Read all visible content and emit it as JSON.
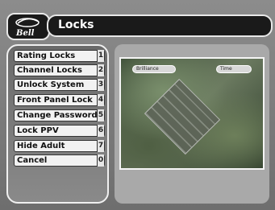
{
  "header": {
    "brand": "Bell",
    "title": "Locks"
  },
  "menu": {
    "items": [
      {
        "label": "Rating Locks",
        "key": "1"
      },
      {
        "label": "Channel Locks",
        "key": "2"
      },
      {
        "label": "Unlock System",
        "key": "3"
      },
      {
        "label": "Front Panel Lock",
        "key": "4"
      },
      {
        "label": "Change Password",
        "key": "5"
      },
      {
        "label": "Lock PPV",
        "key": "6"
      },
      {
        "label": "Hide Adult",
        "key": "7"
      },
      {
        "label": "Cancel",
        "key": "0"
      }
    ]
  },
  "preview": {
    "left_pill": "Brilliance",
    "right_pill": "Time"
  },
  "colors": {
    "title_bar_bg": "#1a1a1a",
    "menu_item_bg": "#f2f2f2",
    "panel_border": "#f0f0f0"
  },
  "icons": {
    "brand_logo": "bell-logo-icon"
  }
}
